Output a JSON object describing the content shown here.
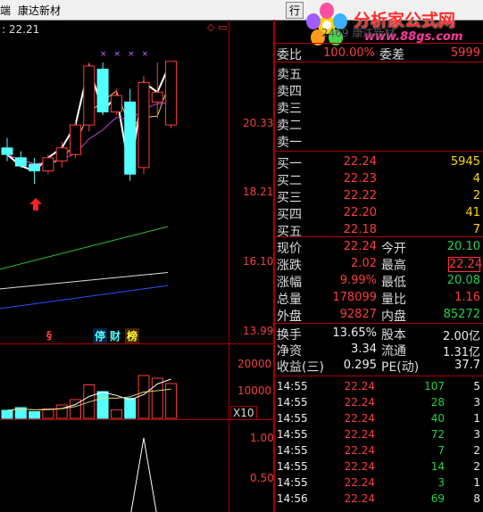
{
  "topbar": {
    "left_fragment": "端",
    "stock_name": "康达新材",
    "hang_fragment": "行"
  },
  "logo": {
    "brand": "分析家公式网",
    "url": "www.88gs.com"
  },
  "chart": {
    "price_readout": ": 22.21",
    "ghost_title": "2469 康达新材",
    "axis_main": [
      "20.33",
      "18.21",
      "16.10",
      "13.99"
    ],
    "axis_volume": [
      "20000",
      "10000"
    ],
    "axis_vol_unit": "X10",
    "axis_indicator": [
      "1.00",
      "0.50"
    ],
    "marker_s": "§",
    "badges": [
      "停",
      "财",
      "榜"
    ],
    "peak_labels": [
      "×",
      "×",
      "×",
      "×"
    ],
    "colors": {
      "candle_up": "#ff3c3c",
      "candle_down": "#54ffff",
      "ma_white": "#ffffff",
      "ma_yellow": "#e0d070",
      "ma_magenta": "#d040d0",
      "ma_green": "#30c030",
      "ma_blue": "#3050ff",
      "grid": "#a00000"
    }
  },
  "chart_data": {
    "type": "line",
    "candles": [
      {
        "o": 19.6,
        "h": 19.9,
        "l": 19.2,
        "c": 19.4
      },
      {
        "o": 19.3,
        "h": 19.5,
        "l": 19.0,
        "c": 19.05
      },
      {
        "o": 19.1,
        "h": 19.3,
        "l": 18.5,
        "c": 18.9
      },
      {
        "o": 18.9,
        "h": 19.4,
        "l": 18.8,
        "c": 19.3
      },
      {
        "o": 19.2,
        "h": 19.8,
        "l": 19.0,
        "c": 19.6
      },
      {
        "o": 19.4,
        "h": 20.4,
        "l": 19.3,
        "c": 20.3
      },
      {
        "o": 20.3,
        "h": 22.2,
        "l": 20.1,
        "c": 22.1
      },
      {
        "o": 22.0,
        "h": 22.2,
        "l": 20.6,
        "c": 20.7
      },
      {
        "o": 20.7,
        "h": 21.4,
        "l": 20.6,
        "c": 21.2
      },
      {
        "o": 21.0,
        "h": 21.4,
        "l": 18.6,
        "c": 18.8
      },
      {
        "o": 19.0,
        "h": 21.8,
        "l": 18.8,
        "c": 21.6
      },
      {
        "o": 21.0,
        "h": 22.2,
        "l": 20.5,
        "c": 21.3
      },
      {
        "o": 20.3,
        "h": 22.24,
        "l": 20.2,
        "c": 22.24
      }
    ],
    "ylim": [
      13.99,
      22.45
    ],
    "volumes": [
      3000,
      4000,
      2500,
      3500,
      5000,
      7000,
      12500,
      10000,
      3200,
      7500,
      16000,
      15000,
      13000
    ],
    "indicator": [
      0,
      0,
      0,
      0,
      0,
      0,
      0,
      0,
      0,
      0,
      1.0,
      0,
      0
    ]
  },
  "quote": {
    "weibi_label": "委比",
    "weibi_value": "100.00%",
    "weicha_label": "委差",
    "weicha_value": "5999",
    "sell": [
      {
        "label": "卖五"
      },
      {
        "label": "卖四"
      },
      {
        "label": "卖三"
      },
      {
        "label": "卖二"
      },
      {
        "label": "卖一"
      }
    ],
    "buy": [
      {
        "label": "买一",
        "price": "22.24",
        "vol": "5945"
      },
      {
        "label": "买二",
        "price": "22.23",
        "vol": "4"
      },
      {
        "label": "买三",
        "price": "22.22",
        "vol": "2"
      },
      {
        "label": "买四",
        "price": "22.20",
        "vol": "41"
      },
      {
        "label": "买五",
        "price": "22.18",
        "vol": "7"
      }
    ],
    "stats": [
      {
        "l1": "现价",
        "v1": "22.24",
        "l2": "今开",
        "v2": "20.10"
      },
      {
        "l1": "涨跌",
        "v1": "2.02",
        "l2": "最高",
        "v2": "22.24"
      },
      {
        "l1": "涨幅",
        "v1": "9.99%",
        "l2": "最低",
        "v2": "20.08"
      },
      {
        "l1": "总量",
        "v1": "178099",
        "l2": "量比",
        "v2": "1.16"
      },
      {
        "l1": "外盘",
        "v1": "92827",
        "l2": "内盘",
        "v2": "85272"
      }
    ],
    "extra": [
      {
        "l1": "换手",
        "v1": "13.65%",
        "l2": "股本",
        "v2": "2.00亿"
      },
      {
        "l1": "净资",
        "v1": "3.34",
        "l2": "流通",
        "v2": "1.31亿"
      },
      {
        "l1": "收益(三)",
        "v1": "0.295",
        "l2": "PE(动)",
        "v2": "37.7"
      }
    ],
    "ticks": [
      {
        "time": "14:55",
        "price": "22.24",
        "vol": "107",
        "n": "5"
      },
      {
        "time": "14:55",
        "price": "22.24",
        "vol": "28",
        "n": "3"
      },
      {
        "time": "14:55",
        "price": "22.24",
        "vol": "40",
        "n": "1"
      },
      {
        "time": "14:55",
        "price": "22.24",
        "vol": "72",
        "n": "3"
      },
      {
        "time": "14:55",
        "price": "22.24",
        "vol": "7",
        "n": "2"
      },
      {
        "time": "14:55",
        "price": "22.24",
        "vol": "14",
        "n": "2"
      },
      {
        "time": "14:55",
        "price": "22.24",
        "vol": "3",
        "n": "1"
      },
      {
        "time": "14:56",
        "price": "22.24",
        "vol": "69",
        "n": "8"
      }
    ]
  }
}
